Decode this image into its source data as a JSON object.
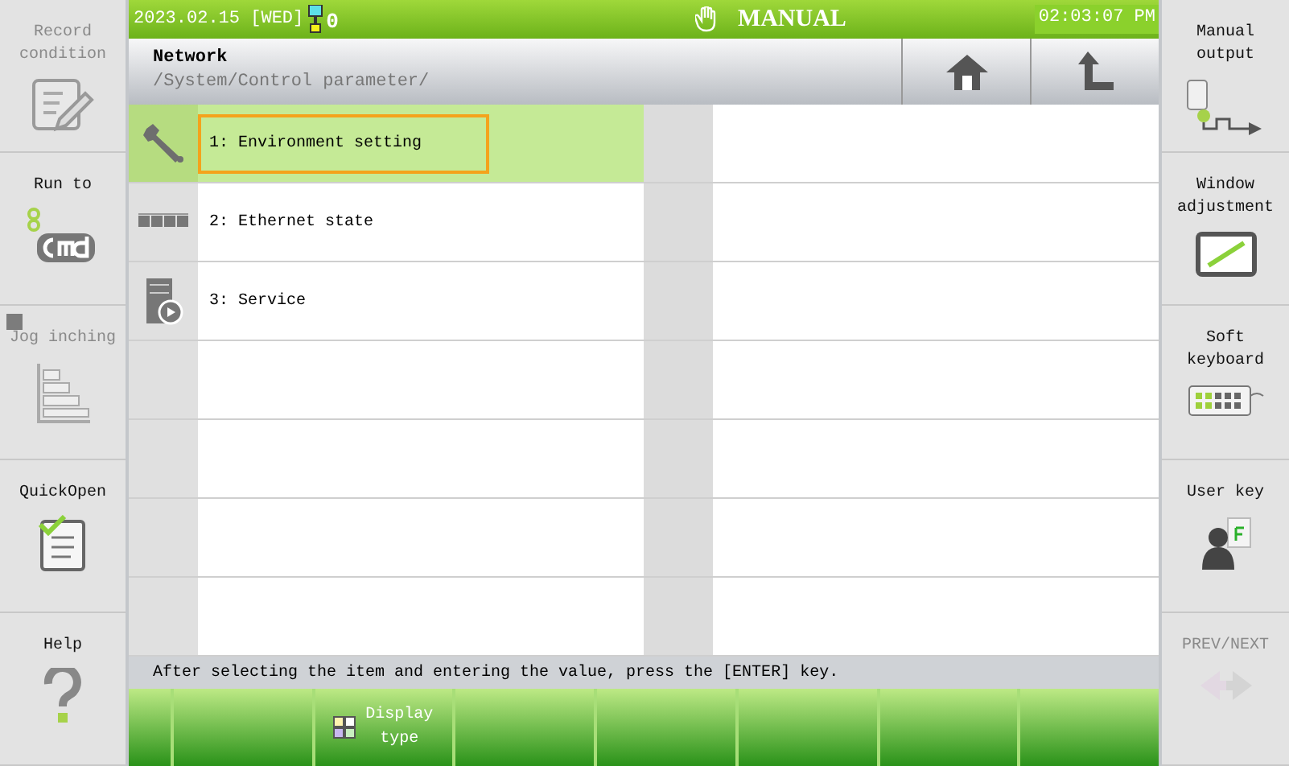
{
  "status_bar": {
    "date": "2023.02.15 [WED]",
    "count": "0",
    "mode": "MANUAL",
    "time": "02:03:07 PM"
  },
  "header": {
    "title": "Network",
    "path": "/System/Control parameter/"
  },
  "left_menu": [
    {
      "kind": "record",
      "label": "Record condition",
      "disabled": true
    },
    {
      "kind": "cmd",
      "label": "Run to",
      "disabled": false
    },
    {
      "kind": "jog",
      "label": "Jog inching",
      "disabled": true
    },
    {
      "kind": "quickopen",
      "label": "QuickOpen",
      "disabled": false
    },
    {
      "kind": "help",
      "label": "Help",
      "disabled": false
    }
  ],
  "items": [
    {
      "kind": "wrench",
      "label": "1: Environment setting",
      "selected": true
    },
    {
      "kind": "ethernet",
      "label": "2: Ethernet state",
      "selected": false
    },
    {
      "kind": "service",
      "label": "3: Service",
      "selected": false
    }
  ],
  "message": "After selecting the item and entering the value, press the [ENTER] key.",
  "function_keys": [
    {
      "kind": "blank"
    },
    {
      "kind": "blank"
    },
    {
      "kind": "display",
      "label": "Display type"
    },
    {
      "kind": "blank"
    },
    {
      "kind": "blank"
    },
    {
      "kind": "blank"
    },
    {
      "kind": "blank"
    },
    {
      "kind": "blank"
    }
  ],
  "right_menu": [
    {
      "kind": "output",
      "label": "Manual output",
      "disabled": false
    },
    {
      "kind": "window",
      "label": "Window adjustment",
      "disabled": false
    },
    {
      "kind": "keyboard",
      "label": "Soft keyboard",
      "disabled": false
    },
    {
      "kind": "userkey",
      "label": "User key",
      "disabled": false
    },
    {
      "kind": "prevnext",
      "label": "PREV/NEXT",
      "disabled": true
    }
  ]
}
